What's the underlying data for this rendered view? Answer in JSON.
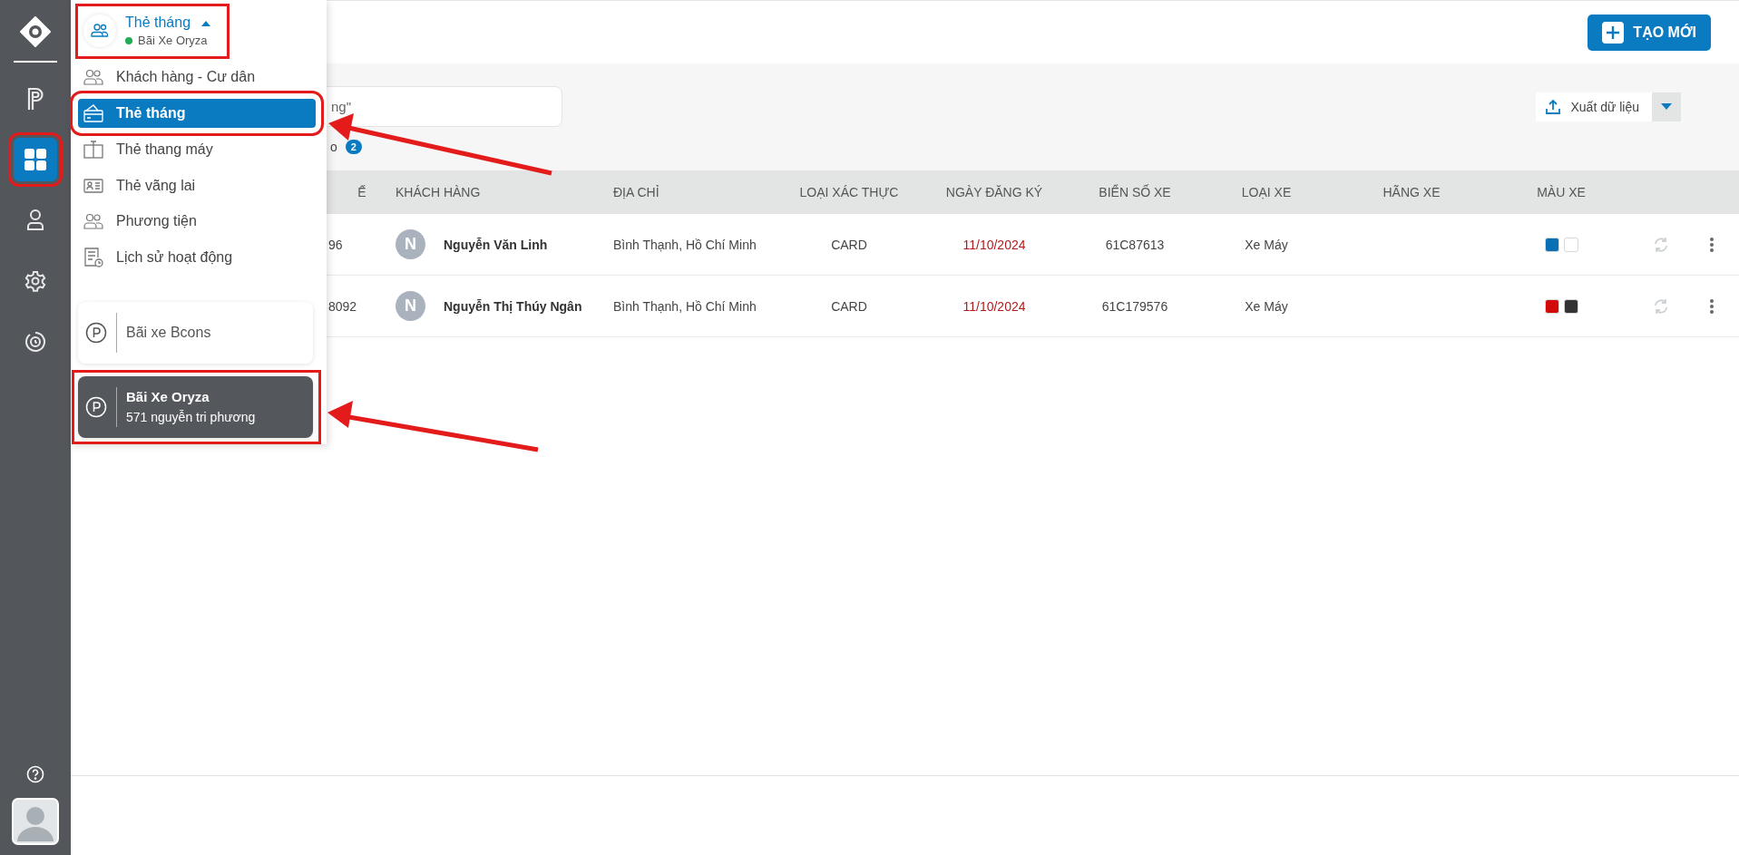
{
  "sidebar": {
    "items": [
      {
        "kind": "parking",
        "selected": false,
        "highlighted": false
      },
      {
        "kind": "apps",
        "selected": true,
        "highlighted": true
      },
      {
        "kind": "person",
        "selected": false,
        "highlighted": false
      },
      {
        "kind": "settings",
        "selected": false,
        "highlighted": false
      },
      {
        "kind": "history",
        "selected": false,
        "highlighted": false
      }
    ]
  },
  "menu": {
    "title": "Thẻ tháng",
    "subtitle": "Bãi Xe Oryza",
    "online": true,
    "expanded": true,
    "highlighted": true,
    "items": [
      {
        "kind": "people",
        "label": "Khách hàng - Cư dân",
        "selected": false,
        "highlighted": false
      },
      {
        "kind": "card",
        "label": "Thẻ tháng",
        "selected": true,
        "highlighted": true,
        "arrow": true
      },
      {
        "kind": "elevator",
        "label": "Thẻ thang máy",
        "selected": false,
        "highlighted": false
      },
      {
        "kind": "id-card",
        "label": "Thẻ vãng lai",
        "selected": false,
        "highlighted": false
      },
      {
        "kind": "people",
        "label": "Phương tiện",
        "selected": false,
        "highlighted": false
      },
      {
        "kind": "log",
        "label": "Lịch sử hoạt động",
        "selected": false,
        "highlighted": false
      }
    ],
    "lots": [
      {
        "name": "Bãi xe Bcons",
        "selected": false,
        "highlighted": false
      },
      {
        "name": "Bãi Xe Oryza",
        "address": "571 nguyễn tri phương",
        "selected": true,
        "highlighted": true,
        "arrow": true
      }
    ]
  },
  "toolbar": {
    "create_button": "TẠO MỚI",
    "search": {
      "placeholder": "ng\""
    },
    "export_button": "Xuất dữ liệu"
  },
  "filter": {
    "label": "o",
    "count": "2"
  },
  "table": {
    "columns": [
      "Ế",
      "KHÁCH HÀNG",
      "ĐỊA CHỈ",
      "LOẠI XÁC THỰC",
      "NGÀY ĐĂNG KÝ",
      "BIỂN SỐ XE",
      "LOẠI XE",
      "HÃNG XE",
      "MÀU XE"
    ],
    "rows": [
      {
        "card": "96",
        "avatar": "N",
        "customer": "Nguyễn Văn Linh",
        "address": "Bình Thạnh, Hồ Chí Minh",
        "auth": "CARD",
        "date": "11/10/2024",
        "plate": "61C87613",
        "type": "Xe Máy",
        "colors": [
          {
            "color": "#0a6fb3"
          },
          {
            "color": "#ffffff"
          }
        ]
      },
      {
        "card": "8092",
        "avatar": "N",
        "customer": "Nguyễn Thị Thúy Ngân",
        "address": "Bình Thạnh, Hồ Chí Minh",
        "auth": "CARD",
        "date": "11/10/2024",
        "plate": "61C179576",
        "type": "Xe Máy",
        "colors": [
          {
            "color": "#d10a0a"
          },
          {
            "color": "#333333"
          }
        ]
      }
    ]
  }
}
